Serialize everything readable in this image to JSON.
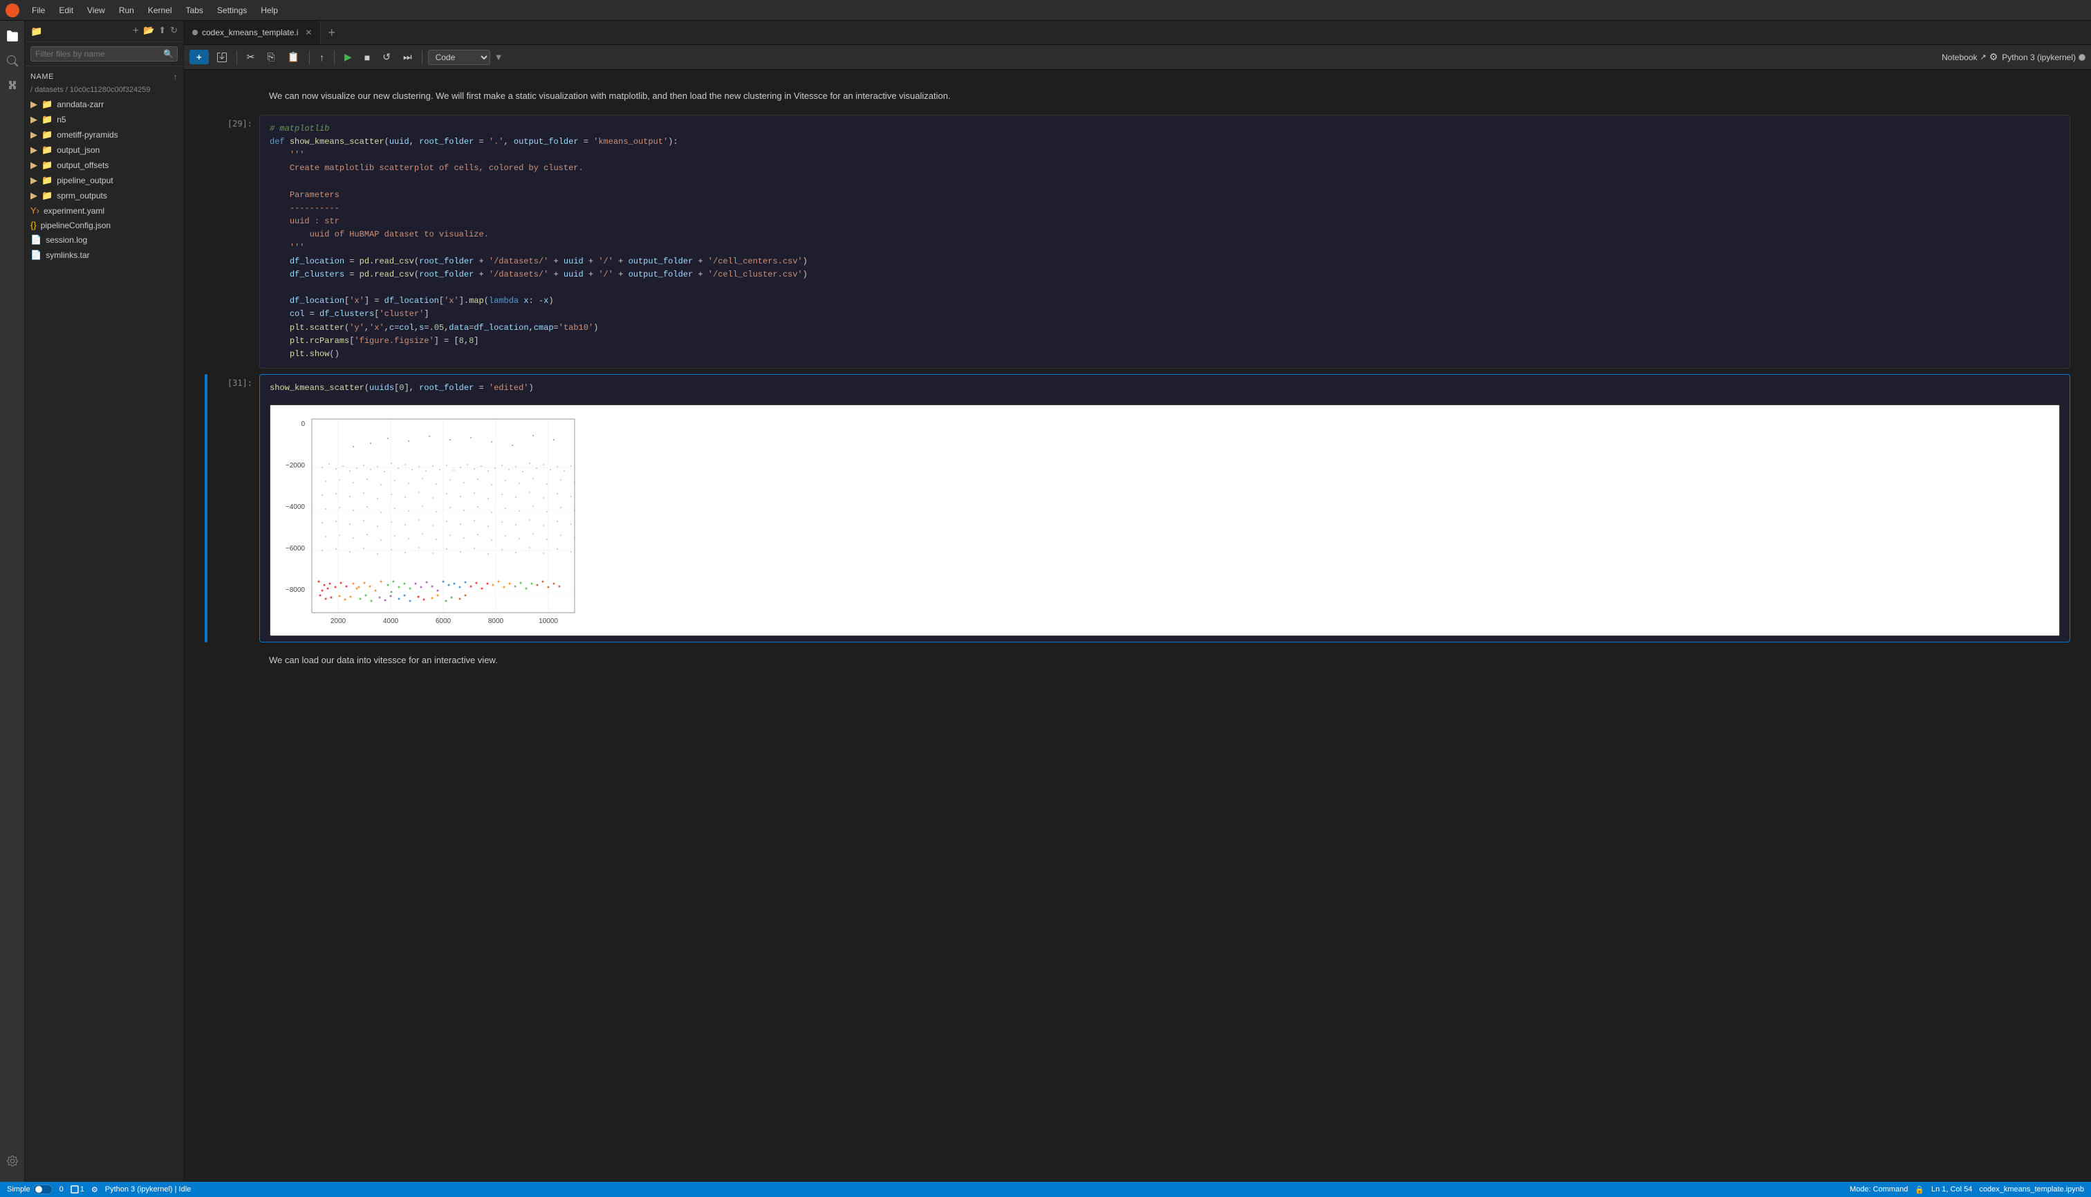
{
  "menubar": {
    "items": [
      "File",
      "Edit",
      "View",
      "Run",
      "Kernel",
      "Tabs",
      "Settings",
      "Help"
    ]
  },
  "left_nav": {
    "icons": [
      "files",
      "search",
      "extensions",
      "settings"
    ]
  },
  "sidebar": {
    "filter_placeholder": "Filter files by name",
    "tree_header": "Name",
    "breadcrumb": "/ datasets / 10c0c11280c00f324259",
    "items": [
      {
        "name": "anndata-zarr",
        "type": "folder"
      },
      {
        "name": "n5",
        "type": "folder"
      },
      {
        "name": "ometiff-pyramids",
        "type": "folder"
      },
      {
        "name": "output_json",
        "type": "folder"
      },
      {
        "name": "output_offsets",
        "type": "folder"
      },
      {
        "name": "pipeline_output",
        "type": "folder"
      },
      {
        "name": "sprm_outputs",
        "type": "folder"
      },
      {
        "name": "experiment.yaml",
        "type": "yaml"
      },
      {
        "name": "pipelineConfig.json",
        "type": "json"
      },
      {
        "name": "session.log",
        "type": "log"
      },
      {
        "name": "symlinks.tar",
        "type": "tar"
      }
    ]
  },
  "tabs": {
    "active": "codex_kmeans_template.i",
    "dot_char": "●"
  },
  "toolbar": {
    "new_label": "+",
    "buttons": [
      "save",
      "cut",
      "copy",
      "paste",
      "move_up",
      "run",
      "stop",
      "restart",
      "fast_forward"
    ],
    "cell_type": "Code",
    "notebook_label": "Notebook",
    "kernel_label": "Python 3 (ipykernel)"
  },
  "cells": [
    {
      "id": "cell_29",
      "label": "[29]:",
      "type": "code",
      "active": false,
      "lines": [
        "# matplotlib",
        "def show_kmeans_scatter(uuid, root_folder = '.', output_folder = 'kmeans_output'):",
        "    '''",
        "    Create matplotlib scatterplot of cells, colored by cluster.",
        "",
        "    Parameters",
        "    ----------",
        "    uuid : str",
        "        uuid of HuBMAP dataset to visualize.",
        "    '''",
        "    df_location = pd.read_csv(root_folder + '/datasets/' + uuid + '/' + output_folder + '/cell_centers.csv')",
        "    df_clusters = pd.read_csv(root_folder + '/datasets/' + uuid + '/' + output_folder + '/cell_cluster.csv')",
        "",
        "    df_location['x'] = df_location['x'].map(lambda x: -x)",
        "    col = df_clusters['cluster']",
        "    plt.scatter('y','x',c=col,s=.05,data=df_location,cmap='tab10')",
        "    plt.rcParams['figure.figsize'] = [8,8]",
        "    plt.show()"
      ]
    },
    {
      "id": "cell_31",
      "label": "[31]:",
      "type": "code",
      "active": true,
      "code_line": "show_kmeans_scatter(uuids[0], root_folder = 'edited')",
      "has_plot": true
    }
  ],
  "plot": {
    "y_labels": [
      "0",
      "-2000",
      "-4000",
      "-6000",
      "-8000"
    ],
    "x_labels": [
      "2000",
      "4000",
      "6000",
      "8000",
      "10000"
    ]
  },
  "footer_text": "We can load our data into vitessce for an interactive view.",
  "header_text": "We can now visualize our new clustering. We will first make a static visualization with matplotlib, and then load the new clustering in Vitessce for an interactive visualization.",
  "statusbar": {
    "mode": "Simple",
    "numbers": "0",
    "page": "1",
    "settings": "⚙",
    "python_status": "Python 3 (ipykernel) | Idle",
    "mode_label": "Mode: Command",
    "position": "Ln 1, Col 54",
    "filename": "codex_kmeans_template.ipynb"
  }
}
